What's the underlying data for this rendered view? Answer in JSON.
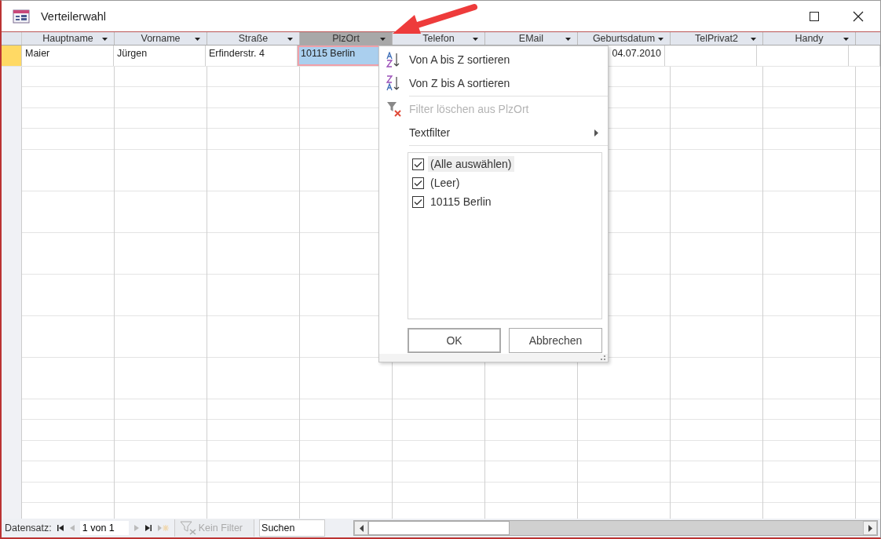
{
  "window": {
    "title": "Verteilerwahl"
  },
  "table": {
    "columns": [
      {
        "label": "Hauptname",
        "selected": false
      },
      {
        "label": "Vorname",
        "selected": false
      },
      {
        "label": "Straße",
        "selected": false
      },
      {
        "label": "PlzOrt",
        "selected": true
      },
      {
        "label": "Telefon",
        "selected": false
      },
      {
        "label": "EMail",
        "selected": false
      },
      {
        "label": "Geburtsdatum",
        "selected": false
      },
      {
        "label": "TelPrivat2",
        "selected": false
      },
      {
        "label": "Handy",
        "selected": false
      }
    ],
    "rows": [
      {
        "current": true,
        "cells": [
          {
            "text": "Maier",
            "selected": false
          },
          {
            "text": "Jürgen",
            "selected": false
          },
          {
            "text": "Erfinderstr. 4",
            "selected": false
          },
          {
            "text": "10115 Berlin",
            "selected": true
          },
          null,
          null,
          {
            "text": "04.07.2010",
            "selected": false,
            "kind": "date"
          },
          {
            "selected": false
          },
          {
            "selected": false
          }
        ]
      }
    ]
  },
  "filter_menu": {
    "items": [
      {
        "kind": "sort-az",
        "label": "Von A bis Z sortieren",
        "disabled": false
      },
      {
        "kind": "sort-za",
        "label": "Von Z bis A sortieren",
        "disabled": false
      },
      {
        "kind": "clear-filter",
        "label": "Filter löschen aus PlzOrt",
        "disabled": true
      },
      {
        "kind": "submenu",
        "label": "Textfilter",
        "disabled": false
      }
    ],
    "values": [
      {
        "label": "(Alle auswählen)",
        "checked": true,
        "selected": true
      },
      {
        "label": "(Leer)",
        "checked": true,
        "selected": false
      },
      {
        "label": "10115 Berlin",
        "checked": true,
        "selected": false
      }
    ],
    "buttons": [
      {
        "label": "OK",
        "default": true
      },
      {
        "label": "Abbrechen",
        "default": false
      }
    ]
  },
  "status_bar": {
    "label": "Datensatz:",
    "record": "1 von 1",
    "filter": "Kein Filter",
    "filter_active": false,
    "search": {
      "placeholder": "Suchen"
    }
  }
}
